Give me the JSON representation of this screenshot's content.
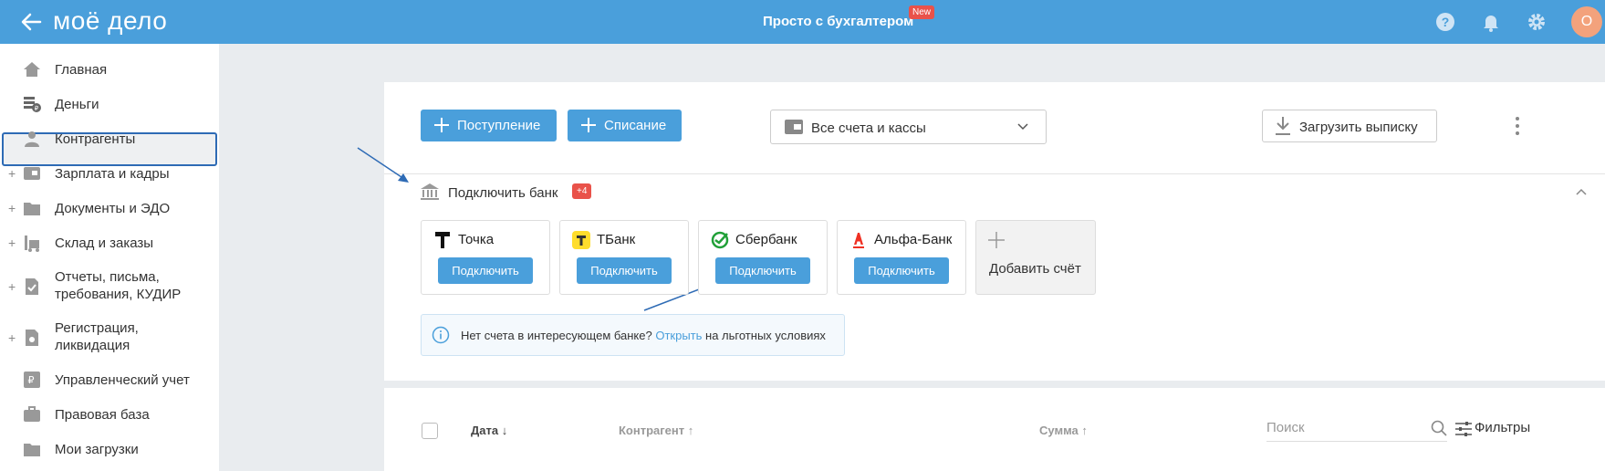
{
  "header": {
    "logo": "моё дело",
    "title": "Просто с бухгалтером",
    "new_badge": "New",
    "avatar_letter": "О"
  },
  "sidebar": {
    "items": [
      {
        "label": "Главная",
        "icon": "home-icon",
        "plus": ""
      },
      {
        "label": "Деньги",
        "icon": "money-icon",
        "plus": "",
        "active": true
      },
      {
        "label": "Контрагенты",
        "icon": "person-icon",
        "plus": ""
      },
      {
        "label": "Зарплата и кадры",
        "icon": "id-card-icon",
        "plus": "+"
      },
      {
        "label": "Документы и ЭДО",
        "icon": "folder-icon",
        "plus": "+"
      },
      {
        "label": "Склад и заказы",
        "icon": "warehouse-icon",
        "plus": "+"
      },
      {
        "label": "Отчеты, письма,",
        "label2": "требования, КУДИР",
        "icon": "report-icon",
        "plus": "+"
      },
      {
        "label": "Регистрация,",
        "label2": "ликвидация",
        "icon": "registration-icon",
        "plus": "+"
      },
      {
        "label": "Управленческий учет",
        "icon": "ruble-chart-icon",
        "plus": ""
      },
      {
        "label": "Правовая база",
        "icon": "briefcase-icon",
        "plus": ""
      },
      {
        "label": "Мои загрузки",
        "icon": "folder-icon",
        "plus": ""
      }
    ]
  },
  "toolbar": {
    "income_label": "Поступление",
    "expense_label": "Списание",
    "accounts_select": "Все счета и кассы",
    "upload_label": "Загрузить выписку"
  },
  "connect": {
    "title": "Подключить банк",
    "count_badge": "+4",
    "banks": [
      {
        "name": "Точка",
        "button": "Подключить"
      },
      {
        "name": "ТБанк",
        "button": "Подключить"
      },
      {
        "name": "Сбербанк",
        "button": "Подключить"
      },
      {
        "name": "Альфа-Банк",
        "button": "Подключить"
      }
    ],
    "add_account": "Добавить счёт",
    "info_text_before": "Нет счета в интересующем банке?",
    "info_link": "Открыть",
    "info_text_after": "на льготных условиях"
  },
  "table": {
    "col_date": "Дата ↓",
    "col_contractor": "Контрагент ↑",
    "col_sum": "Сумма ↑",
    "search_placeholder": "Поиск",
    "filters_label": "Фильтры"
  },
  "colors": {
    "primary": "#4a9fdb",
    "badge": "#e9524a",
    "active_border": "#2e6bb5"
  }
}
